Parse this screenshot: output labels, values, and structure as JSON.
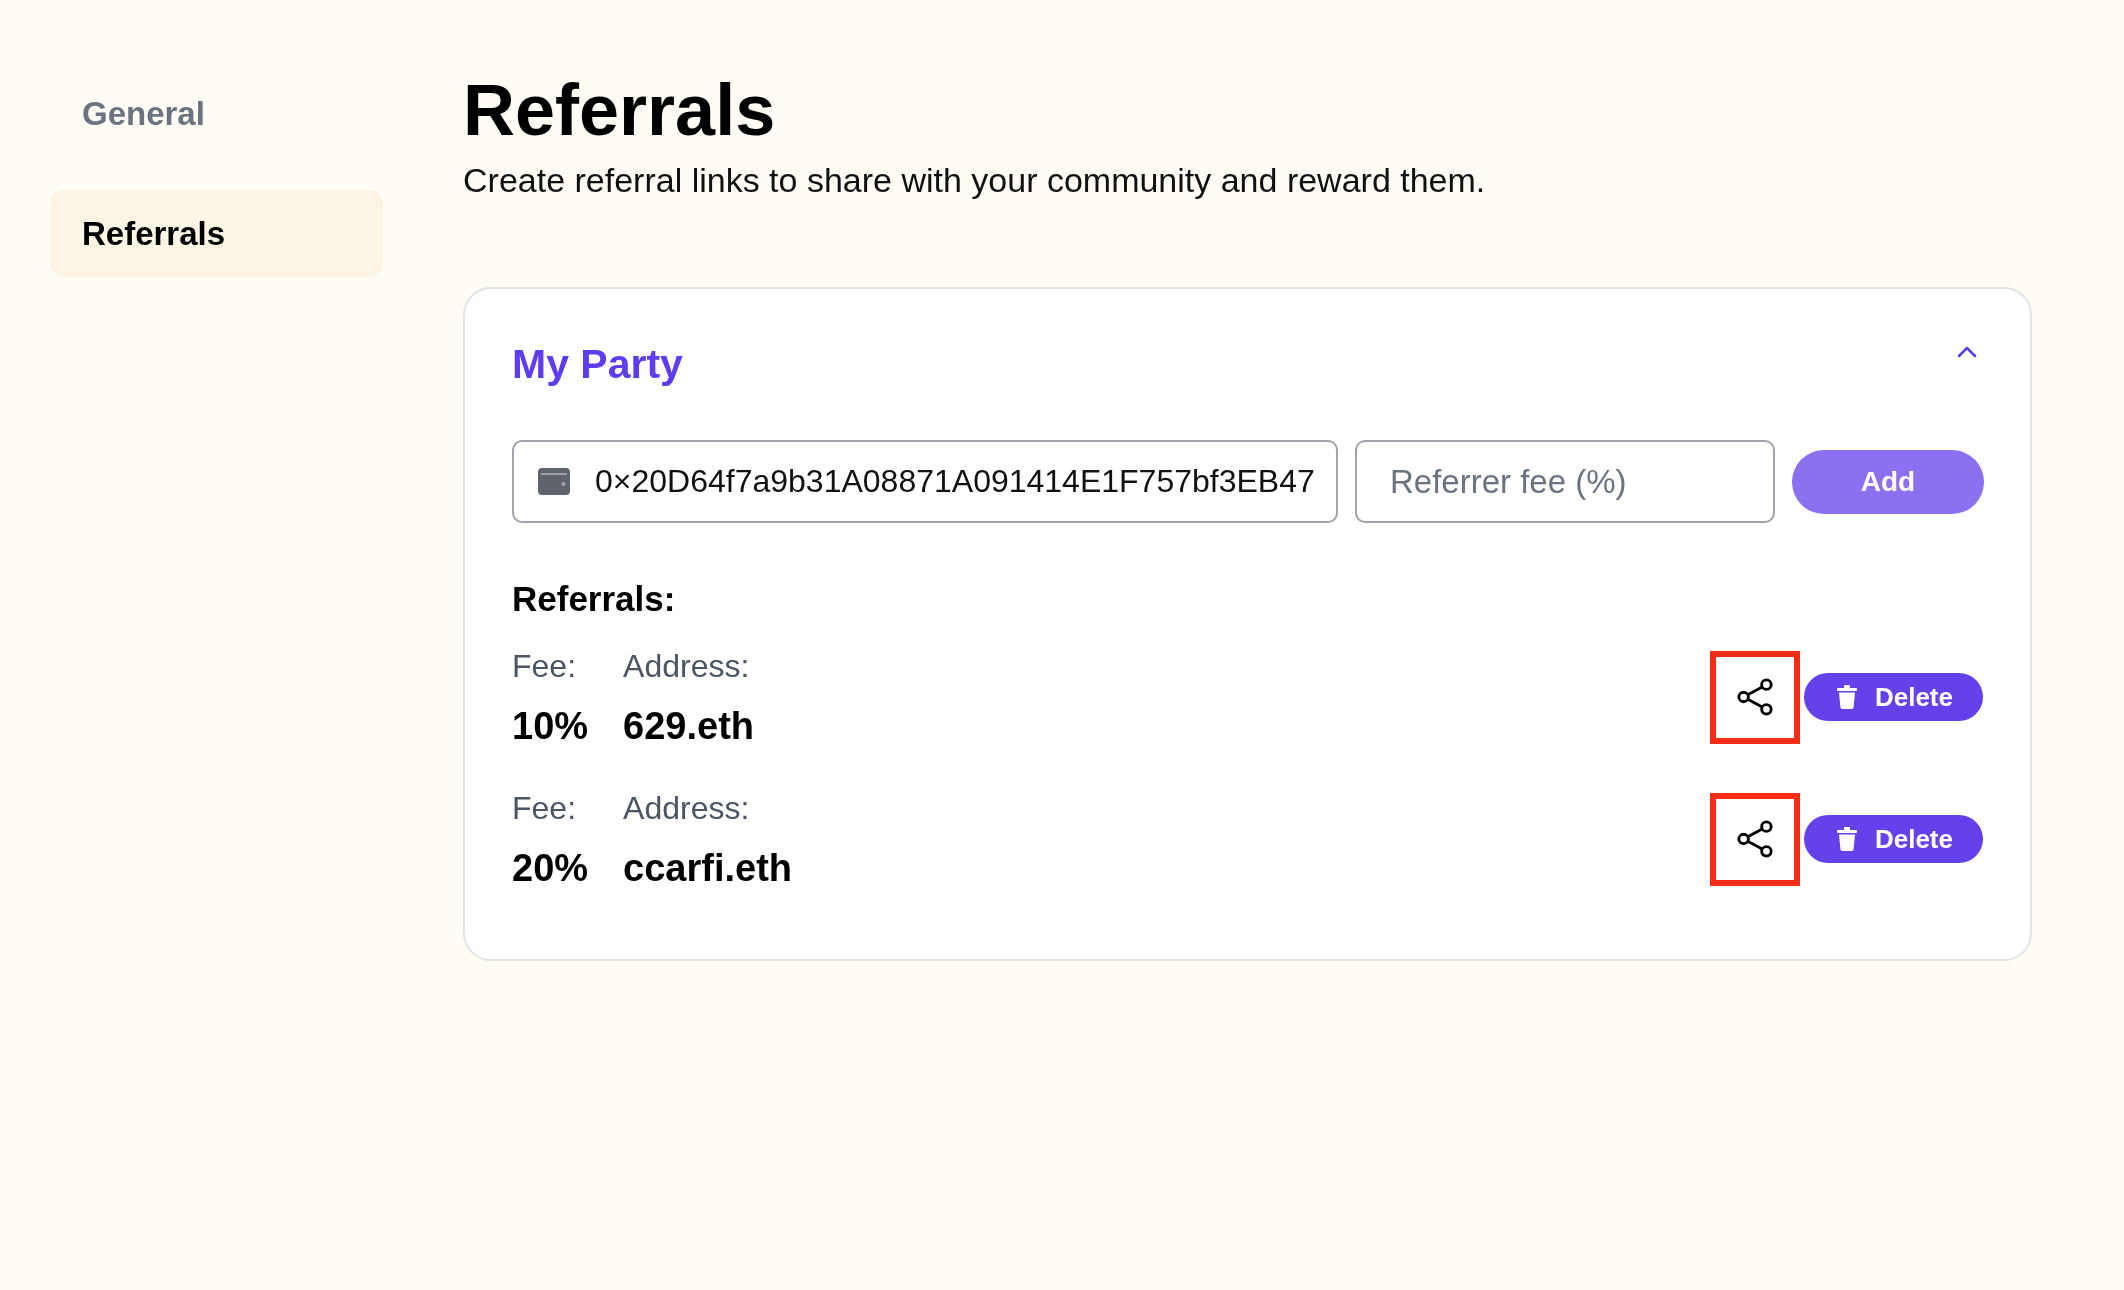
{
  "sidebar": {
    "items": [
      {
        "label": "General",
        "selected": false
      },
      {
        "label": "Referrals",
        "selected": true
      }
    ]
  },
  "header": {
    "title": "Referrals",
    "subtitle": "Create referral links to share with your community and reward them."
  },
  "card": {
    "title": "My Party",
    "expanded": true,
    "form": {
      "address": {
        "value": "0×20D64f7a9b31A08871A091414E1F757bf3EB47"
      },
      "fee": {
        "placeholder": "Referrer fee (%)"
      },
      "add_button": {
        "label": "Add",
        "disabled": true
      }
    },
    "referrals": {
      "heading": "Referrals:",
      "items": [
        {
          "fee_label": "Fee:",
          "fee": "10%",
          "address_label": "Address:",
          "address": "629.eth",
          "highlighted": true,
          "delete_label": "Delete"
        },
        {
          "fee_label": "Fee:",
          "fee": "20%",
          "address_label": "Address:",
          "address": "ccarfi.eth",
          "highlighted": true,
          "delete_label": "Delete"
        }
      ]
    }
  }
}
